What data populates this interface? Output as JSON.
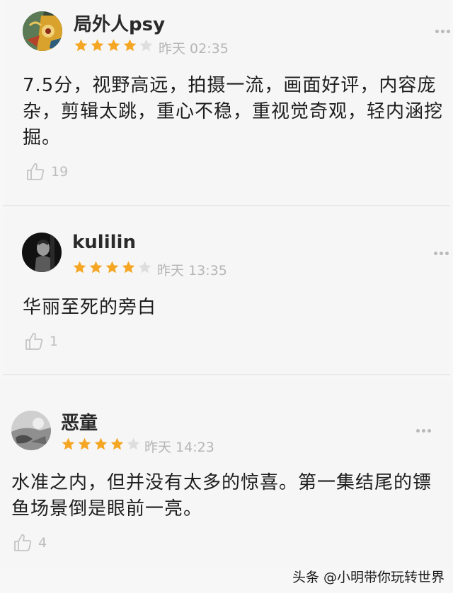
{
  "reviews": [
    {
      "username": "局外人psy",
      "rating": 4,
      "max_rating": 5,
      "time": "昨天 02:35",
      "content_lines": [
        "7.5分，视野高远，拍摄一流，画面好评，内容庞",
        "杂，剪辑太跳，重心不稳，重视觉奇观，轻内涵挖",
        "掘。"
      ],
      "likes": "19"
    },
    {
      "username": "kulilin",
      "rating": 4,
      "max_rating": 5,
      "time": "昨天 13:35",
      "content_lines": [
        "华丽至死的旁白"
      ],
      "likes": "1"
    },
    {
      "username": "恶童",
      "rating": 4,
      "max_rating": 5,
      "time": "昨天 14:23",
      "content_lines": [
        "水准之内，但并没有太多的惊喜。第一集结尾的镖",
        "鱼场景倒是眼前一亮。"
      ],
      "likes": "4"
    }
  ],
  "watermark": "头条 @小明带你玩转世界",
  "colors": {
    "star_filled": "#f5a623",
    "star_empty": "#dedede",
    "muted_text": "#b5b5b5"
  },
  "icons": {
    "more": "more-dots-icon",
    "like": "thumbs-up-icon",
    "star": "star-icon"
  }
}
